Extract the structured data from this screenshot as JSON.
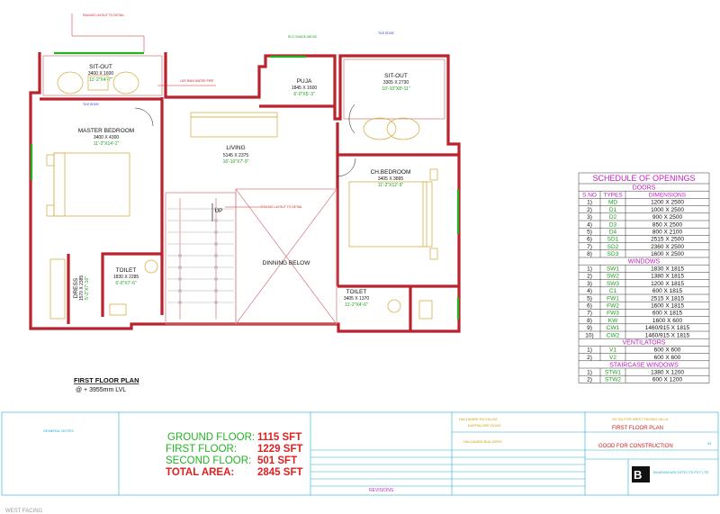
{
  "colors": {
    "wall": "#b8232d",
    "wall_light": "#d9868b",
    "furniture": "#d6b24a",
    "green": "#22b322",
    "red": "#e02020",
    "magenta": "#c21ec2",
    "cyan": "#22aacc",
    "blue": "#2233cc"
  },
  "plan": {
    "title": "FIRST FLOOR PLAN",
    "level": "@ + 3955mm LVL",
    "dining_below": "DINNING BELOW",
    "up": "UP",
    "rooms": [
      {
        "name": "SIT-OUT",
        "dim": "3400 X 1600",
        "ft": "11'-2\"X4'-7\""
      },
      {
        "name": "PUJA",
        "dim": "1845 X 1600",
        "ft": "6'-0\"X5'-3\""
      },
      {
        "name": "SIT-OUT",
        "dim": "3305 X 2730",
        "ft": "10'-10\"X8'-11\""
      },
      {
        "name": "MASTER BEDROOM",
        "dim": "3400 X 4300",
        "ft": "11'-2\"X14'-1\""
      },
      {
        "name": "LIVING",
        "dim": "5145 X 2375",
        "ft": "16'-10\"X7'-9\""
      },
      {
        "name": "CH.BEDROOM",
        "dim": "3405 X 3895",
        "ft": "11'-2\"X12'-9\""
      },
      {
        "name": "TOILET",
        "dim": "1830 X 2285",
        "ft": "6'-0\"X7'-6\""
      },
      {
        "name": "DRESS",
        "dim": "1570 X 2385",
        "ft": "5'-2\"X7'-10\""
      },
      {
        "name": "TOILET",
        "dim": "3405 X 1370",
        "ft": "11'-2\"X4'-6\""
      }
    ],
    "notes": {
      "railing_top": "RAILING LAYOUT TO DETAIL",
      "railing_mid": "RAILING LAYOUT TO DETAIL",
      "rcc_shade": "RCC SHADE ABOVE",
      "tile_edge": "TILE EDGE",
      "drain": "LDR RAIN WATER PIPE",
      "tile_edge2": "TILE EDGE"
    }
  },
  "schedule": {
    "title": "SCHEDULE OF OPENINGS",
    "headers": [
      "S.NO",
      "TYPES",
      "DIMENSIONS"
    ],
    "sections": [
      {
        "name": "DOORS",
        "rows": [
          [
            "1)",
            "MD",
            "1200 X 2500"
          ],
          [
            "2)",
            "D1",
            "1000 X 2500"
          ],
          [
            "3)",
            "D2",
            "900 X 2500"
          ],
          [
            "4)",
            "D3",
            "850 X 2500"
          ],
          [
            "5)",
            "D4",
            "800 X 2100"
          ],
          [
            "6)",
            "SD1",
            "2515 X 2500"
          ],
          [
            "7)",
            "SD2",
            "2360 X 2500"
          ],
          [
            "8)",
            "SD3",
            "1600 X 2500"
          ]
        ]
      },
      {
        "name": "WINDOWS",
        "rows": [
          [
            "1)",
            "SW1",
            "1830 X 1815"
          ],
          [
            "2)",
            "SW2",
            "1380 X 1815"
          ],
          [
            "3)",
            "SW3",
            "1200 X 1815"
          ],
          [
            "4)",
            "C1",
            "600 X 1815"
          ],
          [
            "5)",
            "FW1",
            "2515 X 1815"
          ],
          [
            "6)",
            "FW2",
            "1600 X 1815"
          ],
          [
            "7)",
            "FW3",
            "600 X 1815"
          ],
          [
            "8)",
            "KW",
            "1600 X 600"
          ],
          [
            "9)",
            "CW1",
            "1460/915 X 1815"
          ],
          [
            "10)",
            "CW2",
            "1460/915 X 1815"
          ]
        ]
      },
      {
        "name": "VENTILATORS",
        "rows": [
          [
            "1)",
            "V1",
            "600 X 600"
          ],
          [
            "2)",
            "V2",
            "600 X 600"
          ]
        ]
      },
      {
        "name": "STAIRCASE WINDOWS",
        "rows": [
          [
            "1)",
            "STW1",
            "1380 X 1200"
          ],
          [
            "2)",
            "STW2",
            "600 X 1200"
          ]
        ]
      }
    ]
  },
  "areas": {
    "rows": [
      {
        "label": "GROUND FLOOR:",
        "value": "1115 SFT"
      },
      {
        "label": "FIRST FLOOR:",
        "value": "1229 SFT"
      },
      {
        "label": "SECOND FLOOR:",
        "value": "501 SFT"
      }
    ],
    "total_label": "TOTAL AREA:",
    "total_value": "2845 SFT"
  },
  "title_block": {
    "general_notes": "GENERAL NOTES",
    "project": "HALLMARK RA VILLAS",
    "project_sub": "KAPPALORE ROAD",
    "client": "HALLMARK BUILDERS",
    "drawing": "G2 SQ FOR WEST FACING VILLA",
    "drawing_sub": "FIRST FLOOR PLAN",
    "status": "GOOD FOR CONSTRUCTION",
    "revisions": "REVISIONS",
    "sheet": "04",
    "firm": "BHARANI ARCHITECTS PVT LTD",
    "footer_text": "WEST FACING"
  }
}
